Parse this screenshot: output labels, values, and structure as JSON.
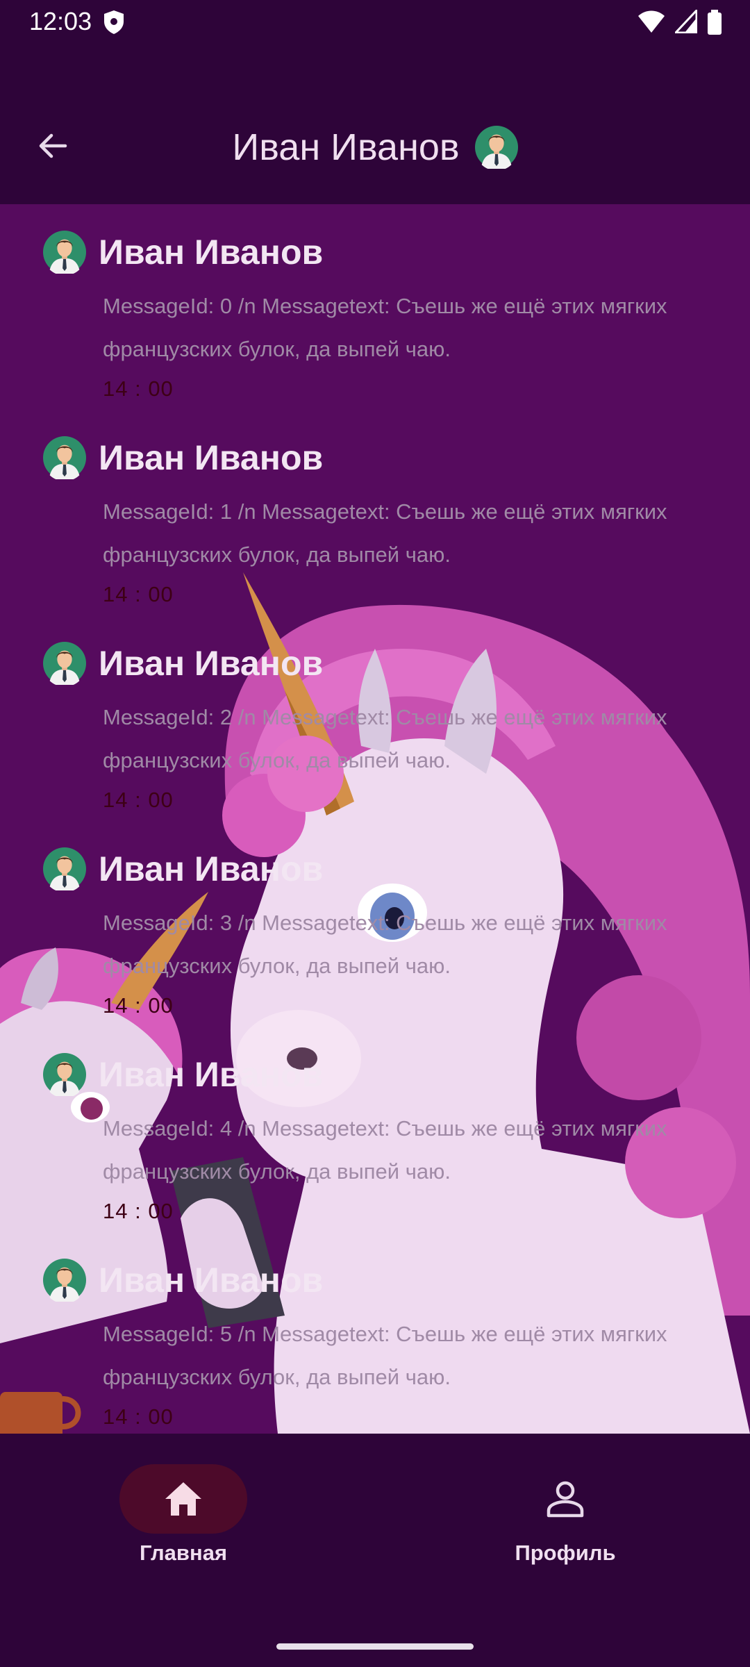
{
  "status_bar": {
    "time": "12:03",
    "icons": [
      "shield-icon",
      "wifi-icon",
      "signal-icon",
      "battery-icon"
    ]
  },
  "app_bar": {
    "title": "Иван Иванов",
    "back_icon": "arrow-back-icon",
    "avatar_icon": "user-avatar-icon"
  },
  "messages": [
    {
      "name": "Иван Иванов",
      "text": "MessageId: 0 /n Messagetext: Съешь же ещё этих мягких французских булок, да выпей чаю.",
      "time": "14 : 00"
    },
    {
      "name": "Иван Иванов",
      "text": "MessageId: 1 /n Messagetext: Съешь же ещё этих мягких французских булок, да выпей чаю.",
      "time": "14 : 00"
    },
    {
      "name": "Иван Иванов",
      "text": "MessageId: 2 /n Messagetext: Съешь же ещё этих мягких французских булок, да выпей чаю.",
      "time": "14 : 00"
    },
    {
      "name": "Иван Иванов",
      "text": "MessageId: 3 /n Messagetext: Съешь же ещё этих мягких французских булок, да выпей чаю.",
      "time": "14 : 00"
    },
    {
      "name": "Иван Иванов",
      "text": "MessageId: 4 /n Messagetext: Съешь же ещё этих мягких французских булок, да выпей чаю.",
      "time": "14 : 00"
    },
    {
      "name": "Иван Иванов",
      "text": "MessageId: 5 /n Messagetext: Съешь же ещё этих мягких французских булок, да выпей чаю.",
      "time": "14 : 00"
    }
  ],
  "bottom_nav": {
    "items": [
      {
        "label": "Главная",
        "icon": "home-icon",
        "selected": true
      },
      {
        "label": "Профиль",
        "icon": "person-icon",
        "selected": false
      }
    ]
  },
  "colors": {
    "bar_background": "#2e0439",
    "chat_background": "#560b5e",
    "nav_pill": "#4d0a2a",
    "title_text": "#f0dff0",
    "message_text": "#a08aa6",
    "time_text": "#3d0015"
  }
}
